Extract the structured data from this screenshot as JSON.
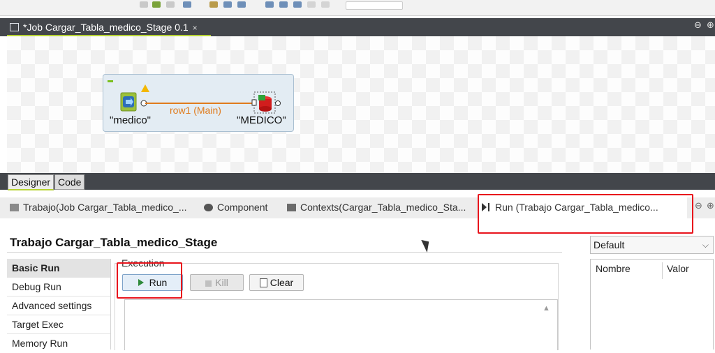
{
  "editor": {
    "tab_title": "*Job Cargar_Tabla_medico_Stage 0.1",
    "close_glyph": "×",
    "minimize_glyph": "⊖",
    "maximize_glyph": "⊕"
  },
  "canvas": {
    "input_component": "\"medico\"",
    "output_component": "\"MEDICO\"",
    "connection_label": "row1 (Main)"
  },
  "designer_tabs": [
    "Designer",
    "Code"
  ],
  "views": {
    "tabs": [
      {
        "label": "Trabajo(Job Cargar_Tabla_medico_..."
      },
      {
        "label": "Component"
      },
      {
        "label": "Contexts(Cargar_Tabla_medico_Sta..."
      },
      {
        "label": "Run (Trabajo Cargar_Tabla_medico..."
      }
    ]
  },
  "run_view": {
    "job_title": "Trabajo Cargar_Tabla_medico_Stage",
    "menu": [
      "Basic Run",
      "Debug Run",
      "Advanced settings",
      "Target Exec",
      "Memory Run"
    ],
    "execution_label": "Execution",
    "run_label": "Run",
    "kill_label": "Kill",
    "clear_label": "Clear",
    "context": {
      "selected": "Default",
      "columns": [
        "Nombre",
        "Valor"
      ]
    }
  },
  "colors": {
    "highlight_box": "#e8141c",
    "connection": "#e07b1c",
    "active_tab_underline": "#b7d433",
    "header_bg": "#43464b"
  },
  "icons": [
    "play-icon",
    "stop-icon",
    "clear-icon",
    "warning-icon",
    "minimize-icon",
    "maximize-icon",
    "chevron-down-icon"
  ]
}
